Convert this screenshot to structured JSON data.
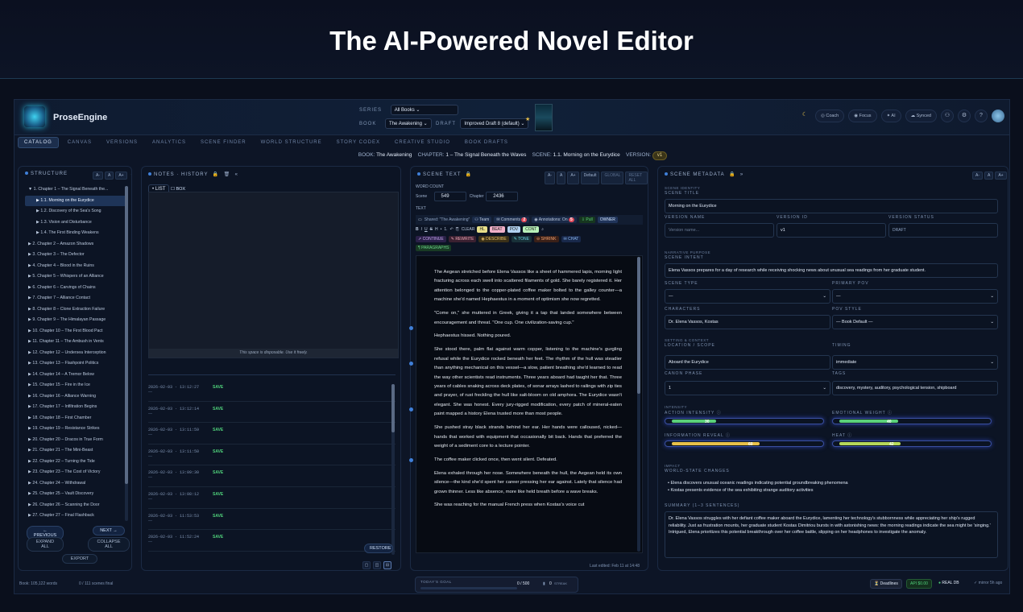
{
  "hero": {
    "title": "The AI-Powered Novel Editor"
  },
  "app": {
    "brand": "ProseEngine"
  },
  "topbar": {
    "series_label": "SERIES",
    "series_value": "All Books",
    "book_label": "BOOK",
    "book_value": "The Awakening",
    "draft_label": "DRAFT",
    "draft_value": "Improved Draft 8 (default)",
    "coach": "Coach",
    "focus": "Focus",
    "ai": "AI",
    "synced": "Synced"
  },
  "tabs": [
    "CATALOG",
    "CANVAS",
    "VERSIONS",
    "ANALYTICS",
    "SCENE FINDER",
    "WORLD STRUCTURE",
    "STORY CODEX",
    "CREATIVE STUDIO",
    "BOOK DRAFTS"
  ],
  "breadcrumb": {
    "book_label": "BOOK:",
    "book": "The Awakening",
    "chapter_label": "CHAPTER:",
    "chapter": "1 – The Signal Beneath the Waves",
    "scene_label": "SCENE:",
    "scene": "1.1. Morning on the Eurydice",
    "version_label": "VERSION:",
    "version": "v1"
  },
  "structure": {
    "title": "STRUCTURE",
    "items": [
      "▼  1. Chapter 1 – The Signal Beneath the...",
      "▶  1.1. Morning on the Eurydice",
      "▶  1.2. Discovery of the Sea's Song",
      "▶  1.3. Vision and Disturbance",
      "▶  1.4. The First Binding Weakens",
      "▶  2. Chapter 2 – Amazon Shadows",
      "▶  3. Chapter 3 – The Defector",
      "▶  4. Chapter 4 – Blood in the Ruins",
      "▶  5. Chapter 5 – Whispers of an Alliance",
      "▶  6. Chapter 6 – Carvings of Chains",
      "▶  7. Chapter 7 – Alliance Contact",
      "▶  8. Chapter 8 – Clone Extraction Failure",
      "▶  9. Chapter 9 – The Himalayan Passage",
      "▶  10. Chapter 10 – The First Blood Pact",
      "▶  11. Chapter 11 – The Ambush in Vents",
      "▶  12. Chapter 12 – Undersea Interception",
      "▶  13. Chapter 13 – Flashpoint Politics",
      "▶  14. Chapter 14 – A Tremor Below",
      "▶  15. Chapter 15 – Fire in the Ice",
      "▶  16. Chapter 16 – Alliance Warning",
      "▶  17. Chapter 17 – Infiltration Begins",
      "▶  18. Chapter 18 – First Chamber",
      "▶  19. Chapter 19 – Resistance Strikes",
      "▶  20. Chapter 20 – Dracos in True Form",
      "▶  21. Chapter 21 – The Mini-Beast",
      "▶  22. Chapter 22 – Turning the Tide",
      "▶  23. Chapter 23 – The Cost of Victory",
      "▶  24. Chapter 24 – Withdrawal",
      "▶  25. Chapter 25 – Vault Discovery",
      "▶  26. Chapter 26 – Scanning the Door",
      "▶  27. Chapter 27 – Final Flashback"
    ],
    "prev": "← PREVIOUS",
    "next": "NEXT →",
    "expand": "EXPAND ALL",
    "collapse": "COLLAPSE ALL",
    "export": "EXPORT"
  },
  "notes": {
    "title": "NOTES · HISTORY",
    "list": "• LIST",
    "box": "☐ BOX",
    "hint": "This space is disposable. Use it freely.",
    "restore": "RESTORE",
    "history": [
      {
        "ts": "2026-02-03 · 13:12:27",
        "act": "SAVE"
      },
      {
        "ts": "2026-02-03 · 13:12:14",
        "act": "SAVE"
      },
      {
        "ts": "2026-02-03 · 13:11:59",
        "act": "SAVE"
      },
      {
        "ts": "2026-02-03 · 13:11:50",
        "act": "SAVE"
      },
      {
        "ts": "2026-02-03 · 13:09:30",
        "act": "SAVE"
      },
      {
        "ts": "2026-02-03 · 13:08:12",
        "act": "SAVE"
      },
      {
        "ts": "2026-02-03 · 11:53:53",
        "act": "SAVE"
      },
      {
        "ts": "2026-02-03 · 11:52:24",
        "act": "SAVE"
      }
    ]
  },
  "scene": {
    "title": "SCENE TEXT",
    "default": "Default",
    "global": "GLOBAL",
    "reset": "RESET ALL",
    "word_count": "WORD COUNT",
    "scene_label": "Scene",
    "scene_count": "549",
    "chapter_label": "Chapter",
    "chapter_count": "2436",
    "text_label": "TEXT",
    "shared": "Shared: \"The Awakening\"",
    "team": "Team",
    "comments": "Comments",
    "annotations": "Annotations: On",
    "pull": "Pull",
    "owner": "OWNER",
    "clear": "CLEAR",
    "hl": "HL",
    "beat": "BEAT",
    "pov": "POV",
    "cont": "CONT",
    "continue": "CONTINUE",
    "rewrite": "REWRITE",
    "describe": "DESCRIBE",
    "tone": "TONE",
    "shrink": "SHRINK",
    "chat": "CHAT",
    "paragraphs": "PARAGRAPHS",
    "last_edited": "Last edited: Feb 11 at 14:48",
    "paragraphs_text": [
      "The Aegean stretched before Elena Vassos like a sheet of hammered lapis, morning light fracturing across each swell into scattered filaments of gold. She barely registered it. Her attention belonged to the copper-plated coffee maker bolted to the galley counter—a machine she'd named Hephaestus in a moment of optimism she now regretted.",
      "\"Come on,\" she muttered in Greek, giving it a tap that landed somewhere between encouragement and threat. \"One cup. One civilization-saving cup.\"",
      "Hephaestus hissed. Nothing poured.",
      "She stood there, palm flat against warm copper, listening to the machine's gurgling refusal while the Eurydice rocked beneath her feet. The rhythm of the hull was steadier than anything mechanical on this vessel—a slow, patient breathing she'd learned to read the way other scientists read instruments. Three years aboard had taught her that. Three years of cables snaking across deck plates, of sonar arrays lashed to railings with zip ties and prayer, of rust freckling the hull like salt-bloom on old amphora. The Eurydice wasn't elegant. She was honest. Every jury-rigged modification, every patch of mineral-eaten paint mapped a history Elena trusted more than most people.",
      "She pushed stray black strands behind her ear. Her hands were calloused, nicked—hands that worked with equipment that occasionally bit back. Hands that preferred the weight of a sediment core to a lecture pointer.",
      "The coffee maker clicked once, then went silent. Defeated.",
      "Elena exhaled through her nose. Somewhere beneath the hull, the Aegean held its own silence—the kind she'd spent her career pressing her ear against. Lately that silence had grown thinner. Less like absence, more like held breath before a wave breaks.",
      "She was reaching for the manual French press when Kostas's voice cut"
    ]
  },
  "meta": {
    "title": "SCENE METADATA",
    "identity": "SCENE IDENTITY",
    "scene_title_label": "SCENE TITLE",
    "scene_title": "Morning on the Eurydice",
    "version_name_label": "VERSION NAME",
    "version_name_ph": "Version name...",
    "version_id_label": "VERSION ID",
    "version_id": "v1",
    "version_status_label": "VERSION STATUS",
    "version_status": "DRAFT",
    "narrative": "NARRATIVE PURPOSE",
    "intent_label": "SCENE INTENT",
    "intent": "Elena Vassos prepares for a day of research while receiving shocking news about unusual sea readings from her graduate student.",
    "scene_type_label": "SCENE TYPE",
    "scene_type": "—",
    "primary_pov_label": "PRIMARY POV",
    "primary_pov": "—",
    "characters_label": "CHARACTERS",
    "characters": "Dr. Elena Vassos, Kostas",
    "pov_style_label": "POV STYLE",
    "pov_style": "— Book Default —",
    "setting": "SETTING & CONTEXT",
    "location_label": "LOCATION / SCOPE",
    "location": "Aboard the Eurydice",
    "timing_label": "TIMING",
    "timing": "immediate",
    "canon_label": "CANON PHASE",
    "canon": "1",
    "tags_label": "TAGS",
    "tags": "discovery, mystery, auditory, psychological tension, shipboard",
    "intensity": "INTENSITY",
    "action_label": "ACTION INTENSITY",
    "action": 30,
    "emotional_label": "EMOTIONAL WEIGHT",
    "emotional": 40,
    "info_label": "INFORMATION REVEAL",
    "info": 60,
    "heat_label": "HEAT",
    "heat": 42,
    "impact": "IMPACT",
    "world_label": "WORLD-STATE CHANGES",
    "world_1": "• Elena discovers unusual oceanic readings indicating potential groundbreaking phenomena",
    "world_2": "• Kostas presents evidence of the sea exhibiting strange auditory activities",
    "summary_label": "SUMMARY (1–3 SENTENCES)",
    "summary": "Dr. Elena Vassos struggles with her defiant coffee maker aboard the Eurydice, lamenting her technology's stubbornness while appreciating her ship's rugged reliability. Just as frustration mounts, her graduate student Kostas Dimitriou bursts in with astonishing news: the morning readings indicate the sea might be 'singing.' Intrigued, Elena prioritizes this potential breakthrough over her coffee battle, slipping on her headphones to investigate the anomaly."
  },
  "footer": {
    "book_words": "Book: 105,122 words",
    "scenes_final": "0 / 111 scenes final",
    "goal_label": "TODAY'S GOAL",
    "goal": "0 / 500",
    "streak": "0",
    "streak_label": "STREAK",
    "deadlines": "Deadlines",
    "api": "API $0.00",
    "realdb": "REAL DB",
    "mirror": "✓ mirror 5h ago"
  },
  "colors": {
    "accent": "#3f7fd8",
    "save": "#4fd07a",
    "action_bar": "#5ad07a",
    "emotional_bar": "#5ad07a",
    "info_bar": "#e8c04a",
    "heat_bar": "#b6d85a"
  }
}
